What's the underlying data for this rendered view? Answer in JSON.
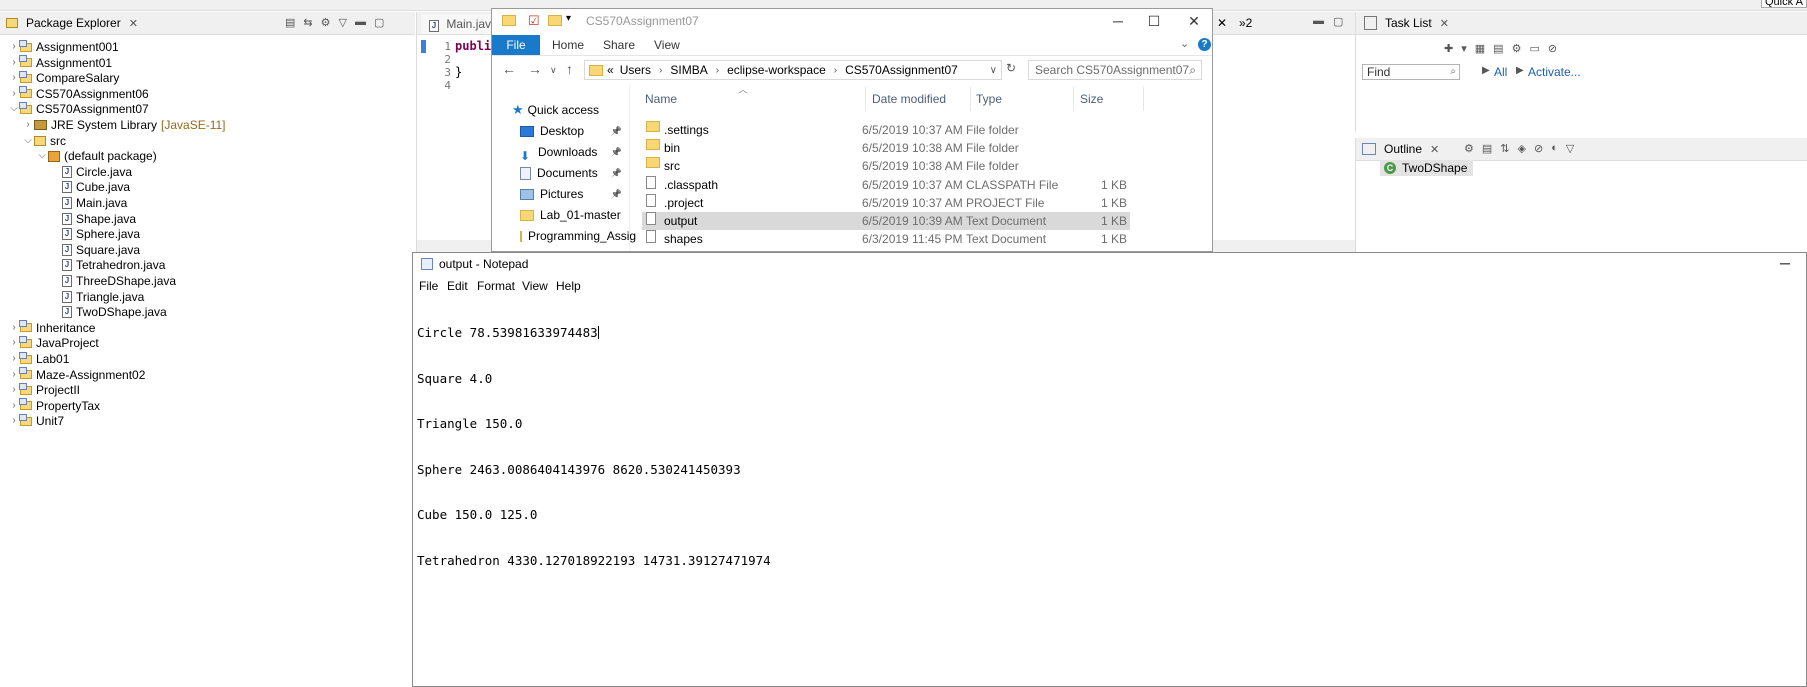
{
  "eclipse": {
    "quick_access": "Quick A",
    "package_explorer": {
      "title": "Package Explorer",
      "tree": [
        {
          "label": "Assignment001",
          "kind": "project",
          "depth": 0,
          "expanded": false
        },
        {
          "label": "Assignment01",
          "kind": "project",
          "depth": 0,
          "expanded": false
        },
        {
          "label": "CompareSalary",
          "kind": "project",
          "depth": 0,
          "expanded": false
        },
        {
          "label": "CS570Assignment06",
          "kind": "project",
          "depth": 0,
          "expanded": false
        },
        {
          "label": "CS570Assignment07",
          "kind": "project",
          "depth": 0,
          "expanded": true
        },
        {
          "label": "JRE System Library",
          "decoration": "[JavaSE-11]",
          "kind": "library",
          "depth": 1,
          "expanded": false
        },
        {
          "label": "src",
          "kind": "source-folder",
          "depth": 1,
          "expanded": true
        },
        {
          "label": "(default package)",
          "kind": "package",
          "depth": 2,
          "expanded": true
        },
        {
          "label": "Circle.java",
          "kind": "java-file",
          "depth": 3
        },
        {
          "label": "Cube.java",
          "kind": "java-file",
          "depth": 3
        },
        {
          "label": "Main.java",
          "kind": "java-file",
          "depth": 3
        },
        {
          "label": "Shape.java",
          "kind": "java-file",
          "depth": 3
        },
        {
          "label": "Sphere.java",
          "kind": "java-file",
          "depth": 3
        },
        {
          "label": "Square.java",
          "kind": "java-file",
          "depth": 3
        },
        {
          "label": "Tetrahedron.java",
          "kind": "java-file",
          "depth": 3
        },
        {
          "label": "ThreeDShape.java",
          "kind": "java-file",
          "depth": 3
        },
        {
          "label": "Triangle.java",
          "kind": "java-file",
          "depth": 3
        },
        {
          "label": "TwoDShape.java",
          "kind": "java-file",
          "depth": 3
        },
        {
          "label": "Inheritance",
          "kind": "project",
          "depth": 0,
          "expanded": false
        },
        {
          "label": "JavaProject",
          "kind": "project",
          "depth": 0,
          "expanded": false
        },
        {
          "label": "Lab01",
          "kind": "project",
          "depth": 0,
          "expanded": false
        },
        {
          "label": "Maze-Assignment02",
          "kind": "project",
          "depth": 0,
          "expanded": false
        },
        {
          "label": "ProjectII",
          "kind": "project",
          "depth": 0,
          "expanded": false
        },
        {
          "label": "PropertyTax",
          "kind": "project",
          "depth": 0,
          "expanded": false
        },
        {
          "label": "Unit7",
          "kind": "project",
          "depth": 0,
          "expanded": false
        }
      ]
    },
    "editor": {
      "tab_label": "Main.java",
      "overflow_label": "»2",
      "line_numbers": [
        "1",
        "2",
        "3",
        "4"
      ],
      "code_keyword": "public",
      "code_brace": "}"
    },
    "task_list": {
      "title": "Task List",
      "find_placeholder": "Find",
      "all_label": "All",
      "activate_label": "Activate..."
    },
    "outline": {
      "title": "Outline",
      "item": "TwoDShape"
    }
  },
  "file_explorer": {
    "title": "CS570Assignment07",
    "ribbon_tabs": [
      "File",
      "Home",
      "Share",
      "View"
    ],
    "breadcrumb": [
      "«",
      "Users",
      "SIMBA",
      "eclipse-workspace",
      "CS570Assignment07"
    ],
    "search_placeholder": "Search CS570Assignment07",
    "nav_items": [
      {
        "label": "Quick access",
        "icon": "star-icon",
        "pinned": false
      },
      {
        "label": "Desktop",
        "icon": "desktop-icon",
        "pinned": true
      },
      {
        "label": "Downloads",
        "icon": "download-icon",
        "pinned": true
      },
      {
        "label": "Documents",
        "icon": "documents-icon",
        "pinned": true
      },
      {
        "label": "Pictures",
        "icon": "pictures-icon",
        "pinned": true
      },
      {
        "label": "Lab_01-master",
        "icon": "folder-icon",
        "pinned": false
      },
      {
        "label": "Programming_Assig",
        "icon": "folder-icon",
        "pinned": false
      }
    ],
    "columns": [
      "Name",
      "Date modified",
      "Type",
      "Size"
    ],
    "files": [
      {
        "name": ".settings",
        "date": "6/5/2019 10:37 AM",
        "type": "File folder",
        "size": "",
        "icon": "folder-icon",
        "selected": false
      },
      {
        "name": "bin",
        "date": "6/5/2019 10:38 AM",
        "type": "File folder",
        "size": "",
        "icon": "folder-icon",
        "selected": false
      },
      {
        "name": "src",
        "date": "6/5/2019 10:38 AM",
        "type": "File folder",
        "size": "",
        "icon": "folder-icon",
        "selected": false
      },
      {
        "name": ".classpath",
        "date": "6/5/2019 10:37 AM",
        "type": "CLASSPATH File",
        "size": "1 KB",
        "icon": "file-icon",
        "selected": false
      },
      {
        "name": ".project",
        "date": "6/5/2019 10:37 AM",
        "type": "PROJECT File",
        "size": "1 KB",
        "icon": "file-icon",
        "selected": false
      },
      {
        "name": "output",
        "date": "6/5/2019 10:39 AM",
        "type": "Text Document",
        "size": "1 KB",
        "icon": "text-file-icon",
        "selected": true
      },
      {
        "name": "shapes",
        "date": "6/3/2019 11:45 PM",
        "type": "Text Document",
        "size": "1 KB",
        "icon": "text-file-icon",
        "selected": false
      }
    ]
  },
  "notepad": {
    "title": "output - Notepad",
    "menu": [
      "File",
      "Edit",
      "Format",
      "View",
      "Help"
    ],
    "lines": [
      "Circle 78.53981633974483",
      "Square 4.0",
      "Triangle 150.0",
      "Sphere 2463.0086404143976 8620.530241450393",
      "Cube 150.0 125.0",
      "Tetrahedron 4330.127018922193 14731.39127471974"
    ]
  }
}
